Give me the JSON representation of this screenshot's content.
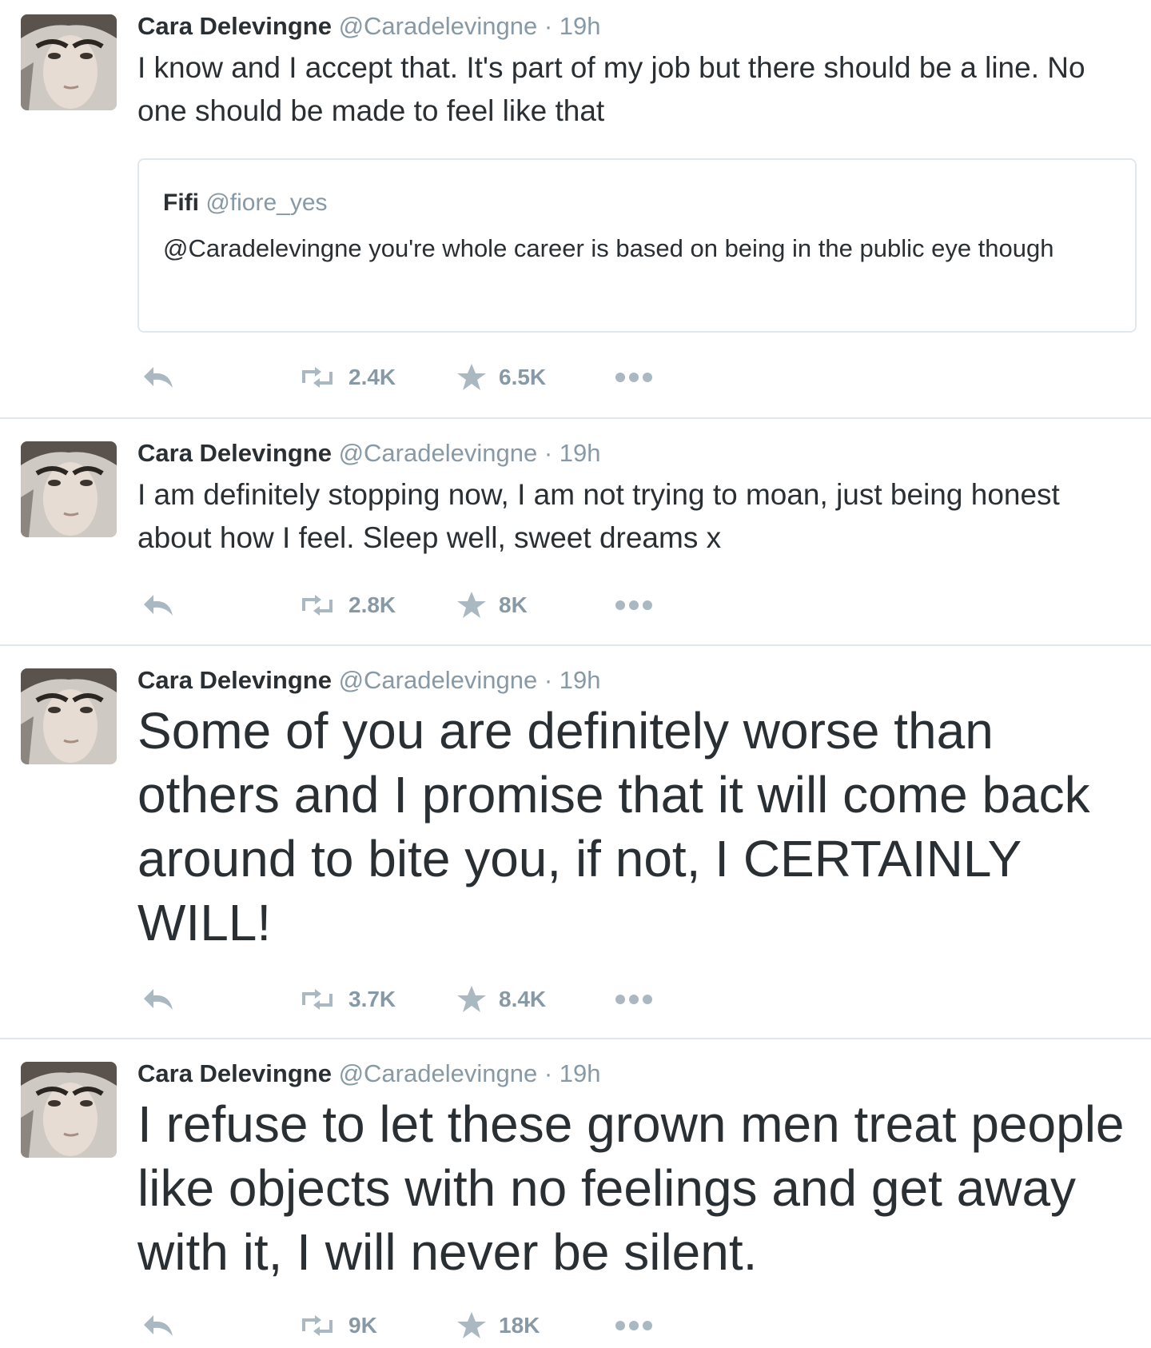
{
  "tweets": [
    {
      "name": "Cara Delevingne",
      "handle": "@Caradelevingne",
      "sep": "·",
      "time": "19h",
      "text": "I know and I accept that. It's part of my job but there should be a line. No one should be made to feel like that",
      "quote": {
        "name": "Fifi",
        "handle": "@fiore_yes",
        "text": "@Caradelevingne you're whole career is based on being in the public eye though"
      },
      "retweets": "2.4K",
      "favorites": "6.5K"
    },
    {
      "name": "Cara Delevingne",
      "handle": "@Caradelevingne",
      "sep": "·",
      "time": "19h",
      "text": "I am definitely stopping now, I am not trying to moan, just being honest about how I feel. Sleep well, sweet dreams x",
      "retweets": "2.8K",
      "favorites": "8K"
    },
    {
      "name": "Cara Delevingne",
      "handle": "@Caradelevingne",
      "sep": "·",
      "time": "19h",
      "text": "Some of you are definitely worse than others and I promise that it will come back around to bite you, if not, I CERTAINLY WILL!",
      "retweets": "3.7K",
      "favorites": "8.4K"
    },
    {
      "name": "Cara Delevingne",
      "handle": "@Caradelevingne",
      "sep": "·",
      "time": "19h",
      "text": "I refuse to let these grown men treat people like objects with no feelings and get away with it, I will never be silent.",
      "retweets": "9K",
      "favorites": "18K"
    }
  ],
  "icons": {
    "reply": "reply-icon",
    "retweet": "retweet-icon",
    "favorite": "star-icon",
    "more": "more-dots-icon"
  },
  "colors": {
    "text": "#292f33",
    "muted": "#8899a6",
    "border": "#e1e8ed",
    "icon": "#aab8c2"
  }
}
